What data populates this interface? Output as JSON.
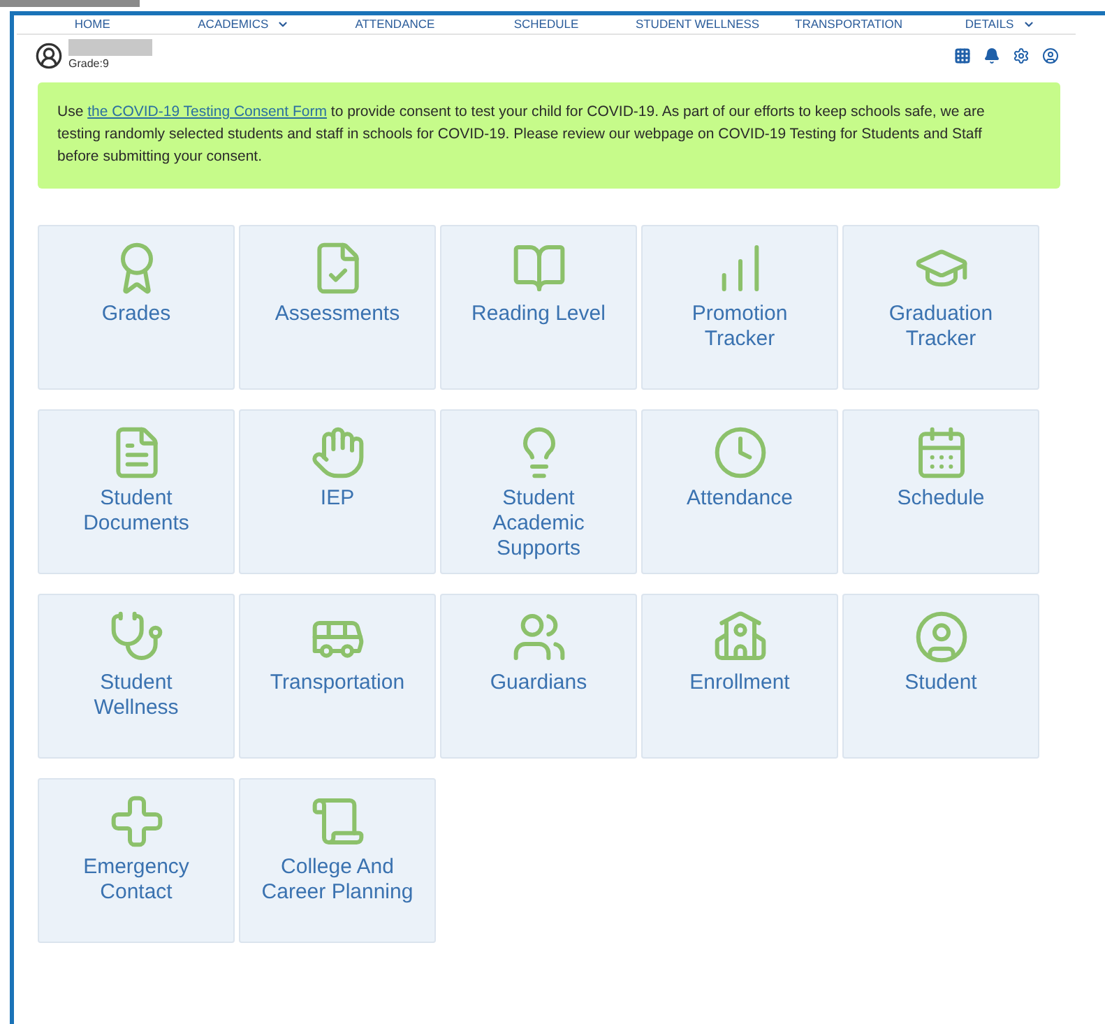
{
  "nav": [
    {
      "label": "HOME",
      "dropdown": false
    },
    {
      "label": "ACADEMICS",
      "dropdown": true
    },
    {
      "label": "ATTENDANCE",
      "dropdown": false
    },
    {
      "label": "SCHEDULE",
      "dropdown": false
    },
    {
      "label": "STUDENT WELLNESS",
      "dropdown": false
    },
    {
      "label": "TRANSPORTATION",
      "dropdown": false
    },
    {
      "label": "DETAILS",
      "dropdown": true
    }
  ],
  "profile": {
    "grade": "Grade:9"
  },
  "notice": {
    "before": "Use ",
    "link": "the COVID-19 Testing Consent Form",
    "after": " to provide consent to test your child for COVID-19. As part of our efforts to keep schools safe, we are testing randomly selected students and staff in schools for COVID-19. Please review our webpage on COVID-19 Testing for Students and Staff before submitting your consent."
  },
  "tiles": [
    {
      "label": "Grades"
    },
    {
      "label": "Assessments"
    },
    {
      "label": "Reading Level"
    },
    {
      "label": "Promotion Tracker"
    },
    {
      "label": "Graduation Tracker"
    },
    {
      "label": "Student Documents"
    },
    {
      "label": "IEP"
    },
    {
      "label": "Student Academic Supports"
    },
    {
      "label": "Attendance"
    },
    {
      "label": "Schedule"
    },
    {
      "label": "Student Wellness"
    },
    {
      "label": "Transportation"
    },
    {
      "label": "Guardians"
    },
    {
      "label": "Enrollment"
    },
    {
      "label": "Student"
    },
    {
      "label": "Emergency Contact"
    },
    {
      "label": "College And Career Planning"
    }
  ]
}
